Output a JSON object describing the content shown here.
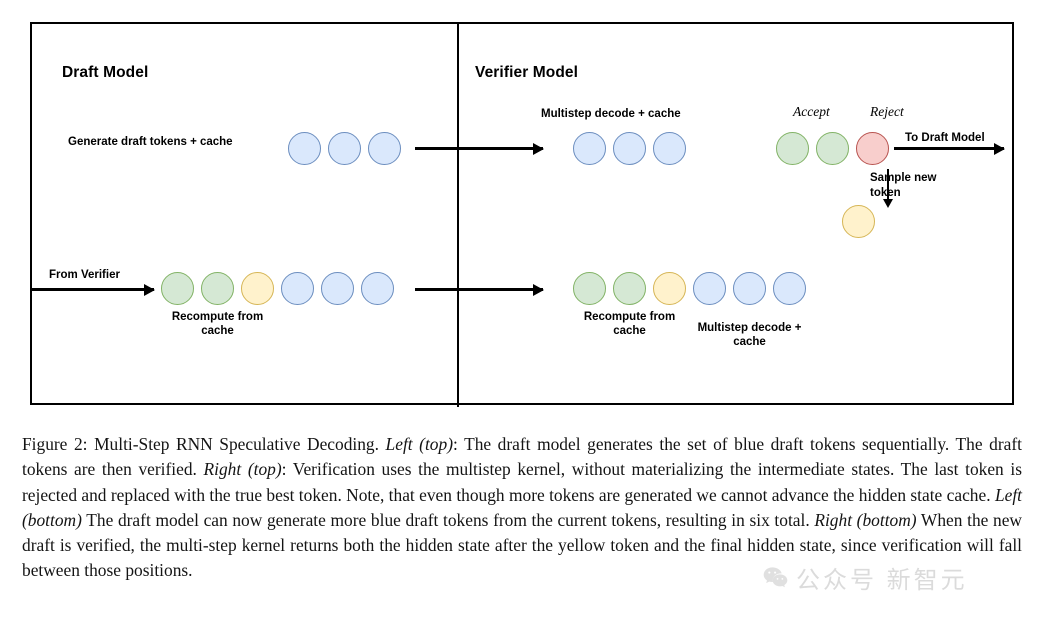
{
  "figure": {
    "panels": {
      "left_title": "Draft Model",
      "right_title": "Verifier Model"
    },
    "labels": {
      "generate_draft": "Generate draft tokens + cache",
      "multistep_decode_cache_top": "Multistep decode + cache",
      "accept": "Accept",
      "reject": "Reject",
      "to_draft_model": "To Draft Model",
      "sample_new_token": "Sample new\ntoken",
      "sample_new_token_line1": "Sample new",
      "sample_new_token_line2": "token",
      "from_verifier": "From Verifier",
      "recompute_from_cache_line1": "Recompute from",
      "recompute_from_cache_line2": "cache",
      "multistep_decode_line1": "Multistep decode +",
      "multistep_decode_line2": "cache"
    },
    "colors": {
      "blue_fill": "#dae8fc",
      "blue_stroke": "#6c8ebf",
      "green_fill": "#d5e8d4",
      "green_stroke": "#82b366",
      "red_fill": "#f8cecc",
      "red_stroke": "#b85450",
      "yellow_fill": "#fff2cc",
      "yellow_stroke": "#d6b656",
      "frame": "#000000"
    },
    "token_rows": {
      "draft_top": [
        "blue",
        "blue",
        "blue"
      ],
      "verifier_top_decode": [
        "blue",
        "blue",
        "blue"
      ],
      "verifier_top_verdict": [
        "green",
        "green",
        "red"
      ],
      "verifier_top_sampled": [
        "yellow"
      ],
      "draft_bottom": [
        "green",
        "green",
        "yellow",
        "blue",
        "blue",
        "blue"
      ],
      "verifier_bottom": [
        "green",
        "green",
        "yellow",
        "blue",
        "blue",
        "blue"
      ]
    }
  },
  "caption": {
    "prefix": "Figure 2: Multi-Step RNN Speculative Decoding. ",
    "em1": "Left (top)",
    "t1": ": The draft model generates the set of blue draft tokens sequentially. The draft tokens are then verified. ",
    "em2": "Right (top)",
    "t2": ": Verification uses the multistep kernel, without materializing the intermediate states. The last token is rejected and replaced with the true best token. Note, that even though more tokens are generated we cannot advance the hidden state cache. ",
    "em3": "Left (bottom)",
    "t3": " The draft model can now generate more blue draft tokens from the current tokens, resulting in six total. ",
    "em4": "Right (bottom)",
    "t4": " When the new draft is verified, the multi-step kernel returns both the hidden state after the yellow token and the final hidden state, since verification will fall between those positions."
  },
  "watermark": {
    "text": "公众号  新智元"
  }
}
